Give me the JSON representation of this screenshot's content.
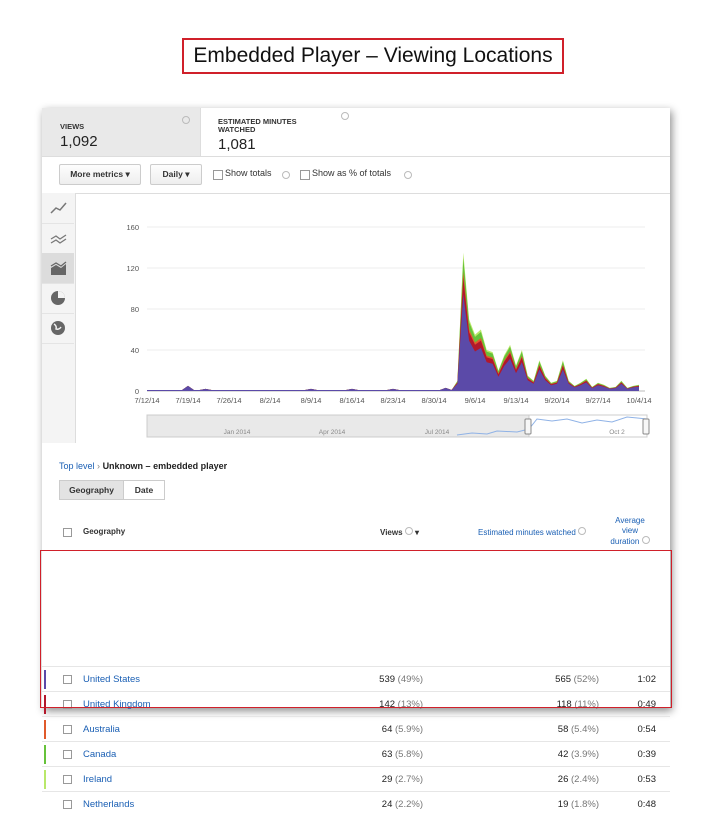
{
  "slide_title": "Embedded Player – Viewing Locations",
  "metrics": {
    "views_label": "VIEWS",
    "views_value": "1,092",
    "minutes_label_1": "ESTIMATED MINUTES",
    "minutes_label_2": "WATCHED",
    "minutes_value": "1,081"
  },
  "toolbar": {
    "more_metrics": "More metrics",
    "interval": "Daily",
    "show_totals": "Show totals",
    "show_pct": "Show as % of totals"
  },
  "chart_data": {
    "type": "area",
    "x": [
      "7/12/14",
      "7/19/14",
      "7/26/14",
      "8/2/14",
      "8/9/14",
      "8/16/14",
      "8/23/14",
      "8/30/14",
      "9/6/14",
      "9/13/14",
      "9/20/14",
      "9/27/14",
      "10/4/14"
    ],
    "ylim": [
      0,
      160
    ],
    "yticks": [
      0,
      40,
      80,
      120,
      160
    ],
    "series": [
      {
        "name": "United States",
        "color": "#5b4aa8"
      },
      {
        "name": "United Kingdom",
        "color": "#b2182b"
      },
      {
        "name": "Australia",
        "color": "#e05a2b"
      },
      {
        "name": "Canada",
        "color": "#66c23a"
      },
      {
        "name": "Ireland",
        "color": "#b9e86a"
      }
    ],
    "totals_peak": 135,
    "navigator_labels": [
      "Jan 2014",
      "Apr 2014",
      "Jul 2014",
      "Oct 2"
    ]
  },
  "breadcrumb": {
    "top": "Top level",
    "sep": "›",
    "current": "Unknown – embedded player"
  },
  "tabs": [
    "Geography",
    "Date"
  ],
  "table": {
    "headers": {
      "geo": "Geography",
      "views": "Views",
      "minutes": "Estimated minutes watched",
      "avg1": "Average",
      "avg2": "view",
      "avg3": "duration"
    },
    "rows": [
      {
        "country": "United States",
        "views": "539",
        "views_pct": "(49%)",
        "mins": "565",
        "mins_pct": "(52%)",
        "dur": "1:02",
        "color": "#5b4aa8"
      },
      {
        "country": "United Kingdom",
        "views": "142",
        "views_pct": "(13%)",
        "mins": "118",
        "mins_pct": "(11%)",
        "dur": "0:49",
        "color": "#b2182b"
      },
      {
        "country": "Australia",
        "views": "64",
        "views_pct": "(5.9%)",
        "mins": "58",
        "mins_pct": "(5.4%)",
        "dur": "0:54",
        "color": "#e05a2b"
      },
      {
        "country": "Canada",
        "views": "63",
        "views_pct": "(5.8%)",
        "mins": "42",
        "mins_pct": "(3.9%)",
        "dur": "0:39",
        "color": "#66c23a"
      },
      {
        "country": "Ireland",
        "views": "29",
        "views_pct": "(2.7%)",
        "mins": "26",
        "mins_pct": "(2.4%)",
        "dur": "0:53",
        "color": "#b9e86a"
      },
      {
        "country": "Netherlands",
        "views": "24",
        "views_pct": "(2.2%)",
        "mins": "19",
        "mins_pct": "(1.8%)",
        "dur": "0:48",
        "color": "#ffffff"
      }
    ]
  }
}
